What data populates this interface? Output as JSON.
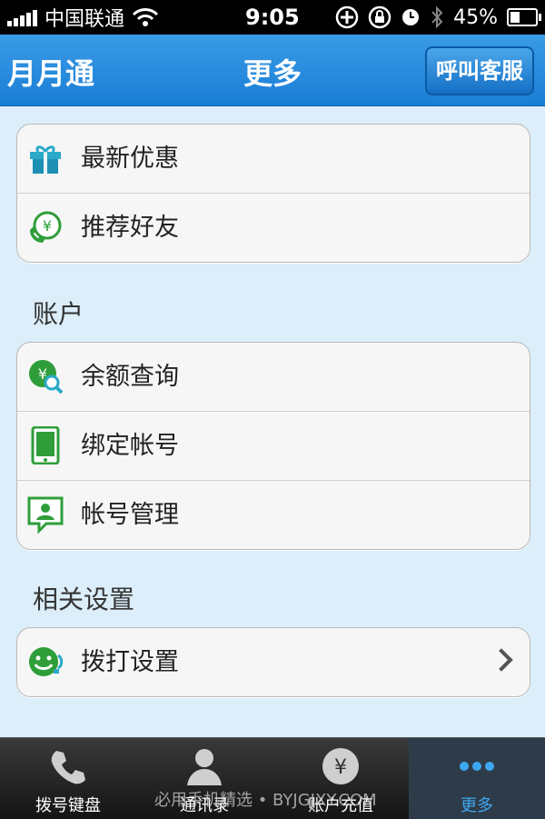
{
  "statusbar": {
    "carrier": "中国联通",
    "time": "9:05",
    "battery": "45%",
    "battery_level": 0.45
  },
  "navbar": {
    "left_label": "月月通",
    "title": "更多",
    "right_button": "呼叫客服"
  },
  "group1": [
    {
      "label": "最新优惠",
      "icon": "gift-icon"
    },
    {
      "label": "推荐好友",
      "icon": "recommend-icon"
    }
  ],
  "section_account": "账户",
  "group2": [
    {
      "label": "余额查询",
      "icon": "balance-search-icon"
    },
    {
      "label": "绑定帐号",
      "icon": "phone-icon"
    },
    {
      "label": "帐号管理",
      "icon": "account-card-icon"
    }
  ],
  "section_settings": "相关设置",
  "group3": [
    {
      "label": "拨打设置",
      "icon": "dial-settings-icon"
    }
  ],
  "tabs": [
    {
      "label": "拨号键盘",
      "icon": "phone-handset-icon"
    },
    {
      "label": "通讯录",
      "icon": "contacts-icon"
    },
    {
      "label": "账户充值",
      "icon": "yuan-coin-icon"
    },
    {
      "label": "更多",
      "icon": "more-dots-icon"
    }
  ],
  "watermark": "必用手机精选 • BYJGJXY.COM",
  "colors": {
    "nav_blue": "#1a7ed6",
    "background": "#dbeef9",
    "icon_green": "#2f9e3a",
    "active_tab": "#3ea7f2"
  }
}
